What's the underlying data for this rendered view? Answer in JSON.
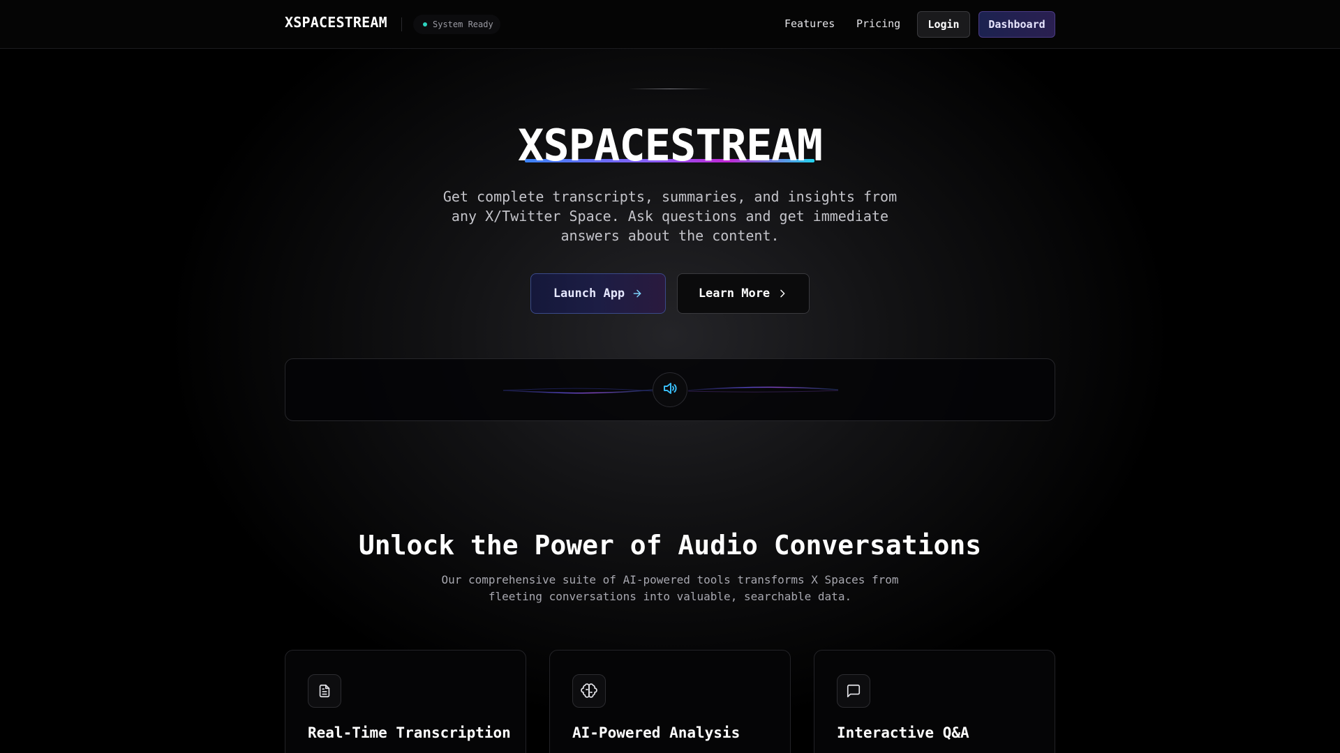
{
  "nav": {
    "brand": "XSPACESTREAM",
    "status": "System Ready",
    "links": [
      "Features",
      "Pricing"
    ],
    "login": "Login",
    "dashboard": "Dashboard"
  },
  "hero": {
    "title": "XSPACESTREAM",
    "subtitle": "Get complete transcripts, summaries, and insights from any X/Twitter Space. Ask questions and get immediate answers about the content.",
    "launch_label": "Launch App",
    "launch_icon": "arrow-right-icon",
    "learn_label": "Learn More",
    "learn_icon": "chevron-right-icon"
  },
  "audio": {
    "icon": "speaker-icon"
  },
  "features": {
    "title": "Unlock the Power of Audio Conversations",
    "subtitle": "Our comprehensive suite of AI-powered tools transforms X Spaces from fleeting conversations into valuable, searchable data.",
    "cards": [
      {
        "title": "Real-Time Transcription",
        "icon": "document-icon"
      },
      {
        "title": "AI-Powered Analysis",
        "icon": "brain-icon"
      },
      {
        "title": "Interactive Q&A",
        "icon": "chat-bubble-icon"
      }
    ]
  },
  "colors": {
    "accent_teal": "#2dd4bf",
    "accent_blue": "#3b82f6",
    "accent_purple": "#8b5cf6",
    "accent_magenta": "#c026d3",
    "accent_cyan": "#22d3ee",
    "background": "#000000"
  }
}
